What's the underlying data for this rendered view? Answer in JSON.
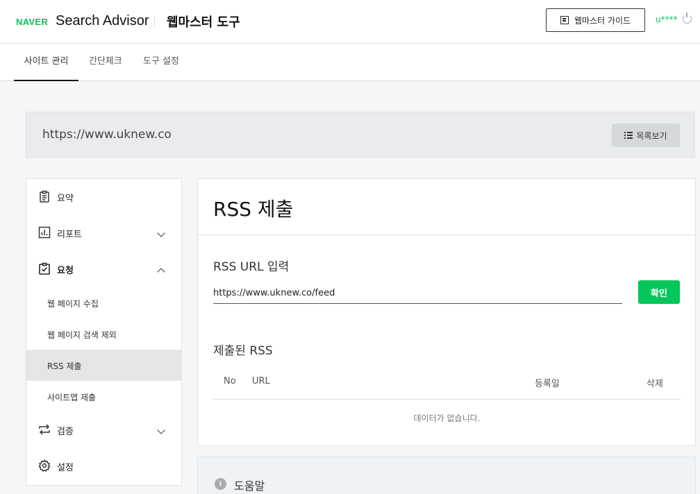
{
  "header": {
    "logo": "NAVER",
    "brand": "Search Advisor",
    "tool_title": "웹마스터 도구",
    "guide_button": "웹마스터 가이드",
    "user_id": "u****"
  },
  "tabs": [
    {
      "label": "사이트 관리",
      "active": true
    },
    {
      "label": "간단체크",
      "active": false
    },
    {
      "label": "도구 설정",
      "active": false
    }
  ],
  "site_bar": {
    "url": "https://www.uknew.co",
    "list_button": "목록보기"
  },
  "sidebar": {
    "items": [
      {
        "label": "요약",
        "icon": "clipboard-icon"
      },
      {
        "label": "리포트",
        "icon": "chart-icon",
        "expanded": false
      },
      {
        "label": "요청",
        "icon": "checklist-icon",
        "expanded": true
      },
      {
        "label": "검증",
        "icon": "repeat-icon",
        "expanded": false
      },
      {
        "label": "설정",
        "icon": "gear-icon"
      }
    ],
    "sub_items": [
      {
        "label": "웹 페이지 수집"
      },
      {
        "label": "웹 페이지 검색 제외"
      },
      {
        "label": "RSS 제출",
        "active": true
      },
      {
        "label": "사이트맵 제출"
      }
    ]
  },
  "main": {
    "title": "RSS 제출",
    "input_label": "RSS URL 입력",
    "input_value": "https://www.uknew.co/feed",
    "confirm_button": "확인",
    "submitted_title": "제출된 RSS",
    "table": {
      "headers": [
        "No",
        "URL",
        "등록일",
        "삭제"
      ],
      "empty_message": "데이터가 없습니다."
    }
  },
  "help": {
    "title": "도움말"
  },
  "colors": {
    "accent": "#03c75a"
  }
}
